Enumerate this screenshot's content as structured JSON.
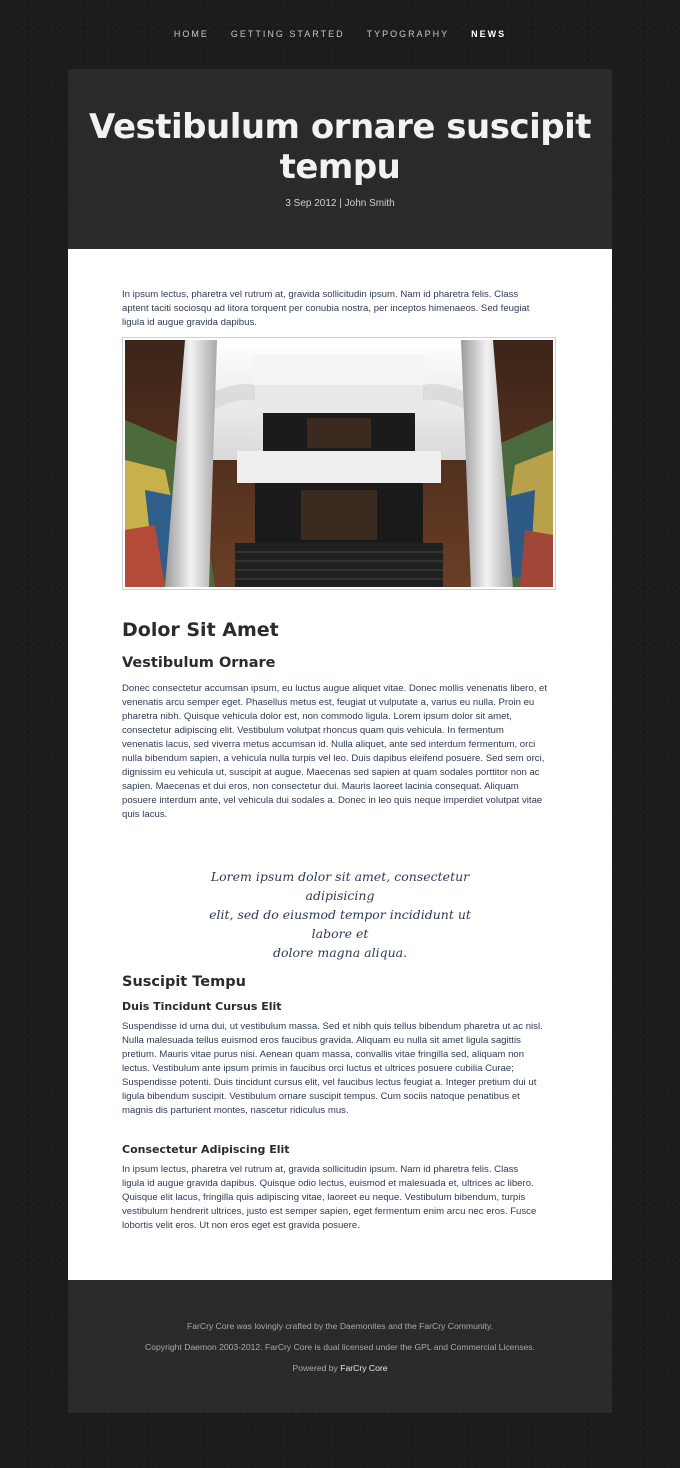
{
  "nav": {
    "items": [
      {
        "label": "HOME"
      },
      {
        "label": "GETTING STARTED"
      },
      {
        "label": "TYPOGRAPHY"
      },
      {
        "label": "NEWS"
      }
    ]
  },
  "header": {
    "title_line1": "Vestibulum ornare suscipit",
    "title_line2": "tempu",
    "meta": "3 Sep 2012 | John Smith"
  },
  "content": {
    "intro": [
      "In ipsum lectus, pharetra vel rutrum at, gravida sollicitudin ipsum. Nam id pharetra felis. Class",
      "aptent taciti sociosqu ad litora torquent per conubia nostra, per inceptos himenaeos. Sed feugiat",
      "ligula id augue gravida dapibus."
    ],
    "image_alt": "atrium",
    "h2": "Dolor Sit Amet",
    "h3": "Vestibulum Ornare",
    "para1": [
      "Donec consectetur accumsan ipsum, eu luctus augue aliquet vitae. Donec mollis venenatis libero, et",
      "venenatis arcu semper eget. Phasellus metus est, feugiat ut vulputate a, varius eu nulla. Proin eu",
      "pharetra nibh. Quisque vehicula dolor est, non commodo ligula. Lorem ipsum dolor sit amet,",
      "consectetur adipiscing elit. Vestibulum volutpat rhoncus quam quis vehicula. In fermentum",
      "venenatis lacus, sed viverra metus accumsan id. Nulla aliquet, ante sed interdum fermentum, orci",
      "nulla bibendum sapien, a vehicula nulla turpis vel leo. Duis dapibus eleifend posuere. Sed sem orci,",
      "dignissim eu vehicula ut, suscipit at augue. Maecenas sed sapien at quam sodales porttitor non ac",
      "sapien. Maecenas et dui eros, non consectetur dui. Mauris laoreet lacinia consequat. Aliquam",
      "posuere interdum ante, vel vehicula dui sodales a. Donec in leo quis neque imperdiet volutpat vitae",
      "quis lacus."
    ],
    "quote": [
      "Lorem ipsum dolor sit amet, consectetur adipisicing",
      "elit, sed do eiusmod tempor incididunt ut labore et",
      "dolore magna aliqua."
    ],
    "h3b": "Suscipit Tempu",
    "h4a": "Duis Tincidunt Cursus Elit",
    "para2": [
      "Suspendisse id urna dui, ut vestibulum massa. Sed et nibh quis tellus bibendum pharetra ut ac nisl.",
      "Nulla malesuada tellus euismod eros faucibus gravida. Aliquam eu nulla sit amet ligula sagittis",
      "pretium. Mauris vitae purus nisi. Aenean quam massa, convallis vitae fringilla sed, aliquam non",
      "lectus. Vestibulum ante ipsum primis in faucibus orci luctus et ultrices posuere cubilia Curae;",
      "Suspendisse potenti. Duis tincidunt cursus elit, vel faucibus lectus feugiat a. Integer pretium dui ut",
      "ligula bibendum suscipit. Vestibulum ornare suscipit tempus. Cum sociis natoque penatibus et",
      "magnis dis parturient montes, nascetur ridiculus mus."
    ],
    "h4b": "Consectetur Adipiscing Elit",
    "para3": [
      "In ipsum lectus, pharetra vel rutrum at, gravida sollicitudin ipsum. Nam id pharetra felis. Class",
      "ligula id augue gravida dapibus. Quisque odio lectus, euismod et malesuada et, ultrices ac libero.",
      "Quisque elit lacus, fringilla quis adipiscing vitae, laoreet eu neque. Vestibulum bibendum, turpis",
      "vestibulum hendrerit ultrices, justo est semper sapien, eget fermentum enim arcu nec eros. Fusce",
      "lobortis velit eros. Ut non eros eget est gravida posuere."
    ]
  },
  "footer": {
    "line1": "FarCry Core was lovingly crafted by the Daemonites and the FarCry Community.",
    "line2": "Copyright Daemon 2003-2012. FarCry Core is dual licensed under the GPL and Commercial Licenses.",
    "powered_prefix": "Powered by ",
    "powered_link": "FarCry Core"
  },
  "colors": {
    "page_bg": "#1c1c1c",
    "panel_bg": "#2a2a2a",
    "body_text": "#2f3b55",
    "heading": "#2b2b2b"
  }
}
